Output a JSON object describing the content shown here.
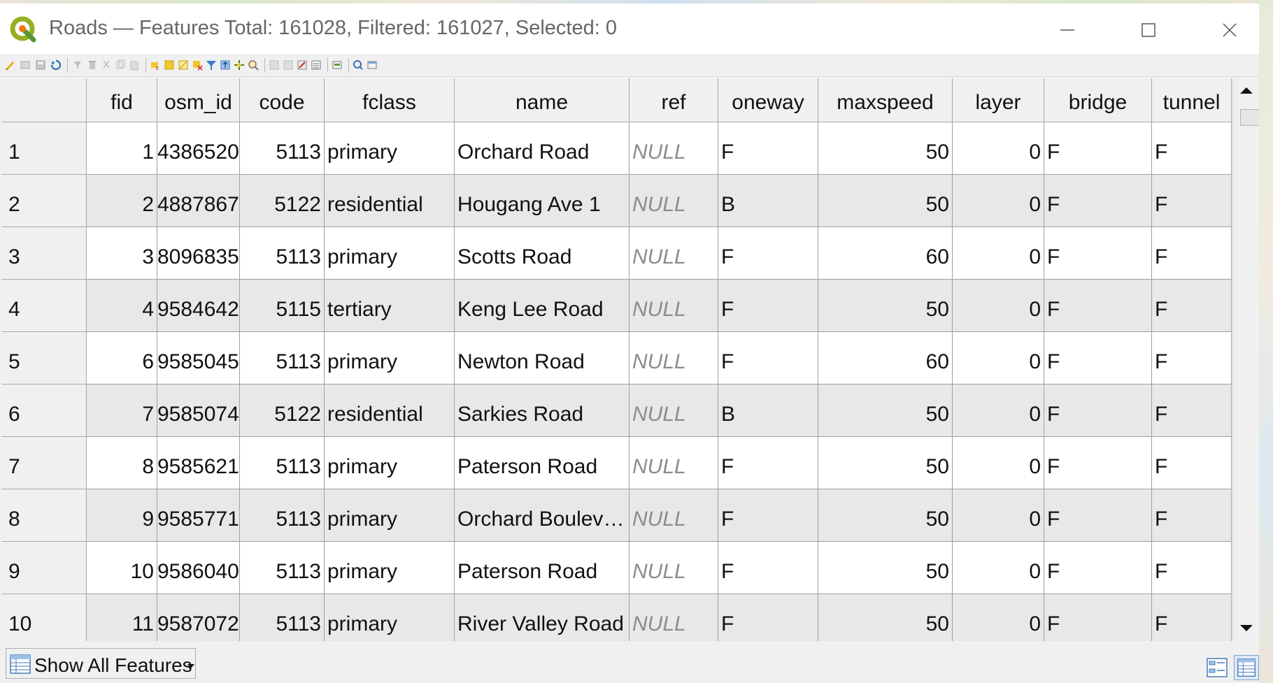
{
  "window": {
    "title": "Roads — Features Total: 161028, Filtered: 161027, Selected: 0",
    "app_icon": "qgis-logo-icon",
    "controls": [
      "minimize-icon",
      "maximize-icon",
      "close-icon"
    ]
  },
  "toolbar": {
    "icons": [
      "toggle-editing-icon",
      "toggle-multi-edit-icon",
      "save-edits-icon",
      "reload-table-icon",
      "add-feature-icon",
      "delete-selected-icon",
      "cut-icon",
      "copy-icon",
      "paste-icon",
      "select-by-expression-icon",
      "select-all-icon",
      "invert-selection-icon",
      "deselect-all-icon",
      "filter-select-icon",
      "move-selection-top-icon",
      "pan-to-selected-icon",
      "zoom-to-selected-icon",
      "new-field-icon",
      "delete-field-icon",
      "organize-columns-icon",
      "field-calculator-icon",
      "conditional-formatting-icon",
      "actions-icon",
      "dock-icon"
    ]
  },
  "table": {
    "columns": [
      "fid",
      "osm_id",
      "code",
      "fclass",
      "name",
      "ref",
      "oneway",
      "maxspeed",
      "layer",
      "bridge",
      "tunnel"
    ],
    "rows": [
      {
        "row": "1",
        "cells": [
          "1",
          "4386520",
          "5113",
          "primary",
          "Orchard Road",
          "NULL",
          "F",
          "50",
          "0",
          "F",
          "F"
        ]
      },
      {
        "row": "2",
        "cells": [
          "2",
          "4887867",
          "5122",
          "residential",
          "Hougang Ave 1",
          "NULL",
          "B",
          "50",
          "0",
          "F",
          "F"
        ]
      },
      {
        "row": "3",
        "cells": [
          "3",
          "8096835",
          "5113",
          "primary",
          "Scotts Road",
          "NULL",
          "F",
          "60",
          "0",
          "F",
          "F"
        ]
      },
      {
        "row": "4",
        "cells": [
          "4",
          "9584642",
          "5115",
          "tertiary",
          "Keng Lee Road",
          "NULL",
          "F",
          "50",
          "0",
          "F",
          "F"
        ]
      },
      {
        "row": "5",
        "cells": [
          "6",
          "9585045",
          "5113",
          "primary",
          "Newton Road",
          "NULL",
          "F",
          "60",
          "0",
          "F",
          "F"
        ]
      },
      {
        "row": "6",
        "cells": [
          "7",
          "9585074",
          "5122",
          "residential",
          "Sarkies Road",
          "NULL",
          "B",
          "50",
          "0",
          "F",
          "F"
        ]
      },
      {
        "row": "7",
        "cells": [
          "8",
          "9585621",
          "5113",
          "primary",
          "Paterson Road",
          "NULL",
          "F",
          "50",
          "0",
          "F",
          "F"
        ]
      },
      {
        "row": "8",
        "cells": [
          "9",
          "9585771",
          "5113",
          "primary",
          "Orchard Bouleva…",
          "NULL",
          "F",
          "50",
          "0",
          "F",
          "F"
        ]
      },
      {
        "row": "9",
        "cells": [
          "10",
          "9586040",
          "5113",
          "primary",
          "Paterson Road",
          "NULL",
          "F",
          "50",
          "0",
          "F",
          "F"
        ]
      },
      {
        "row": "10",
        "cells": [
          "11",
          "9587072",
          "5113",
          "primary",
          "River Valley Road",
          "NULL",
          "F",
          "50",
          "0",
          "F",
          "F"
        ]
      }
    ]
  },
  "scrollbar": {
    "position_fraction": 0.0
  },
  "bottom": {
    "filter_label": "Show All Features",
    "filter_icon": "table-icon",
    "form_view_icon": "form-view-icon",
    "table_view_icon": "table-view-icon"
  },
  "colors": {
    "alt_row": "#e8e8e6",
    "null_text": "#8c8c8c",
    "header_bg": "#f0f0f0"
  }
}
